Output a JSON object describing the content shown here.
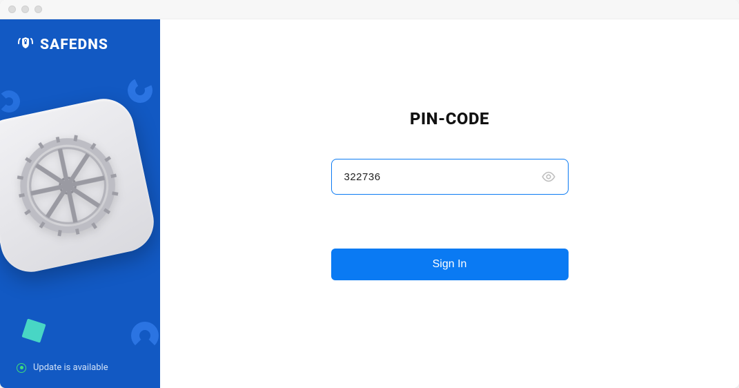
{
  "brand": {
    "name": "SAFEDNS"
  },
  "sidebar": {
    "status_text": "Update is available"
  },
  "main": {
    "title": "PIN-CODE",
    "pin_value": "322736",
    "pin_placeholder": "",
    "signin_label": "Sign In"
  },
  "colors": {
    "accent": "#0a7af3",
    "sidebar_bg": "#1259c3",
    "status_ok": "#3fe07a"
  }
}
